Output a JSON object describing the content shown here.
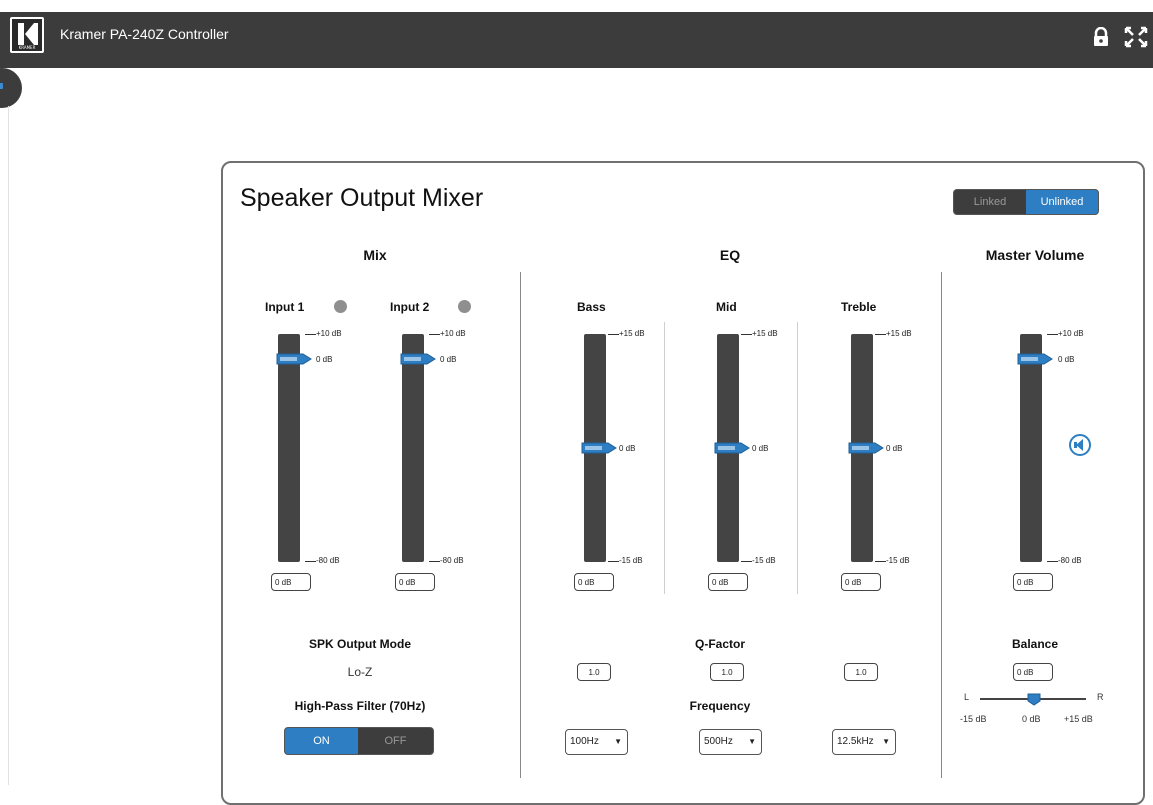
{
  "app": {
    "title": "Kramer PA-240Z Controller",
    "logo_text": "KRAMER"
  },
  "panel": {
    "title": "Speaker Output Mixer",
    "link_options": {
      "linked": "Linked",
      "unlinked": "Unlinked",
      "selected": "Unlinked"
    }
  },
  "sections": {
    "mix": "Mix",
    "eq": "EQ",
    "master": "Master Volume"
  },
  "mix": {
    "channels": [
      {
        "label": "Input 1",
        "top_tick": "+10 dB",
        "zero_tick": "0 dB",
        "bottom_tick": "-80 dB",
        "value": "0 dB",
        "level_db": 0
      },
      {
        "label": "Input 2",
        "top_tick": "+10 dB",
        "zero_tick": "0 dB",
        "bottom_tick": "-80 dB",
        "value": "0 dB",
        "level_db": 0
      }
    ],
    "spk_output_mode_label": "SPK Output Mode",
    "spk_output_mode_value": "Lo-Z",
    "hpf_label": "High-Pass Filter (70Hz)",
    "hpf_on": "ON",
    "hpf_off": "OFF",
    "hpf_state": "ON"
  },
  "eq": {
    "bands": [
      {
        "label": "Bass",
        "top_tick": "+15 dB",
        "zero_tick": "0 dB",
        "bottom_tick": "-15 dB",
        "value": "0 dB",
        "level_db": 0,
        "q": "1.0",
        "frequency": "100Hz"
      },
      {
        "label": "Mid",
        "top_tick": "+15 dB",
        "zero_tick": "0 dB",
        "bottom_tick": "-15 dB",
        "value": "0 dB",
        "level_db": 0,
        "q": "1.0",
        "frequency": "500Hz"
      },
      {
        "label": "Treble",
        "top_tick": "+15 dB",
        "zero_tick": "0 dB",
        "bottom_tick": "-15 dB",
        "value": "0 dB",
        "level_db": 0,
        "q": "1.0",
        "frequency": "12.5kHz"
      }
    ],
    "q_factor_label": "Q-Factor",
    "frequency_label": "Frequency"
  },
  "master": {
    "top_tick": "+10 dB",
    "zero_tick": "0 dB",
    "bottom_tick": "-80 dB",
    "value": "0 dB",
    "level_db": 0,
    "balance_label": "Balance",
    "balance_value": "0 dB",
    "balance_left": "L",
    "balance_right": "R",
    "balance_min": "-15 dB",
    "balance_mid": "0 dB",
    "balance_max": "+15 dB",
    "balance_level_db": 0
  },
  "colors": {
    "accent": "#2d7ec2",
    "topbar": "#3c3c3c",
    "track": "#444444",
    "led": "#8f8f8f"
  },
  "icons": {
    "lock": "lock-icon",
    "expand": "expand-icon",
    "mute": "speaker-mute-icon"
  }
}
